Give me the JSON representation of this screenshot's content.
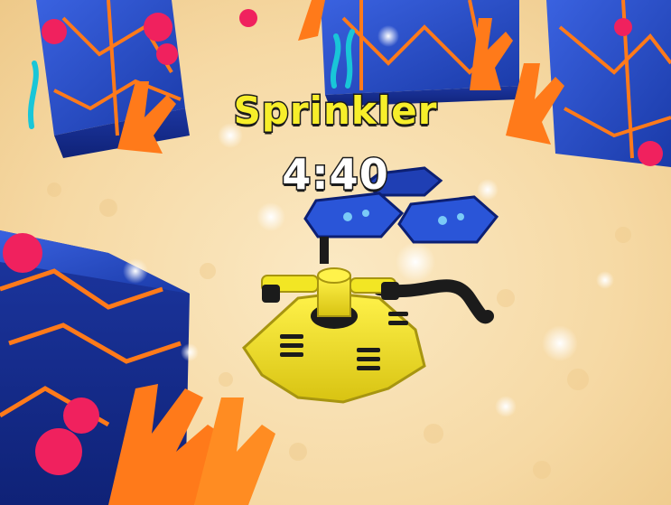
{
  "game": {
    "item_name": "Sprinkler",
    "item_timer": "4:40"
  },
  "colors": {
    "sand": "#f6d9a4",
    "block_blue": "#1f3fb4",
    "block_trim": "#ff7a1a",
    "coral_orange": "#ff7a1a",
    "coral_pink": "#f0215e",
    "sprinkler_yellow": "#f2e624",
    "name_text": "#f7ee2a",
    "timer_text": "#ffffff"
  },
  "icons": [
    "sprinkler-icon",
    "coral-icon",
    "pad-icon"
  ]
}
